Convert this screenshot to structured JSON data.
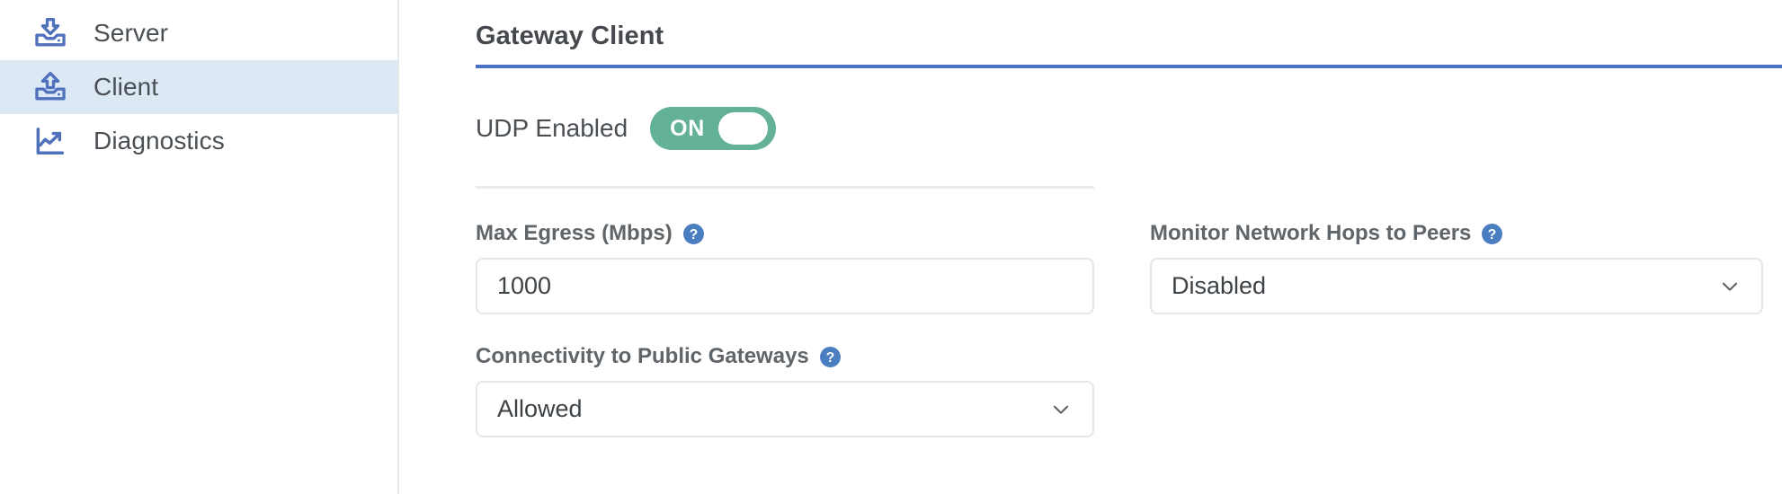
{
  "sidebar": {
    "items": [
      {
        "label": "Server",
        "icon": "tray-download-icon",
        "active": false
      },
      {
        "label": "Client",
        "icon": "tray-upload-icon",
        "active": true
      },
      {
        "label": "Diagnostics",
        "icon": "line-chart-icon",
        "active": false
      }
    ]
  },
  "main": {
    "title": "Gateway Client",
    "toggle": {
      "label": "UDP Enabled",
      "state_text": "ON",
      "on": true,
      "on_color": "#64b296"
    },
    "fields": {
      "max_egress": {
        "label": "Max Egress (Mbps)",
        "help": "help-icon",
        "value": "1000",
        "type": "input"
      },
      "monitor_hops": {
        "label": "Monitor Network Hops to Peers",
        "help": "help-icon",
        "value": "Disabled",
        "type": "select"
      },
      "public_gateways": {
        "label": "Connectivity to Public Gateways",
        "help": "help-icon",
        "value": "Allowed",
        "type": "select"
      }
    }
  },
  "colors": {
    "accent_blue": "#4a6fc4",
    "icon_blue": "#5071bb",
    "help_blue": "#4a7ec0",
    "active_row": "#dce9f5",
    "toggle_green": "#64b296",
    "border_gray": "#e6e7e9"
  }
}
